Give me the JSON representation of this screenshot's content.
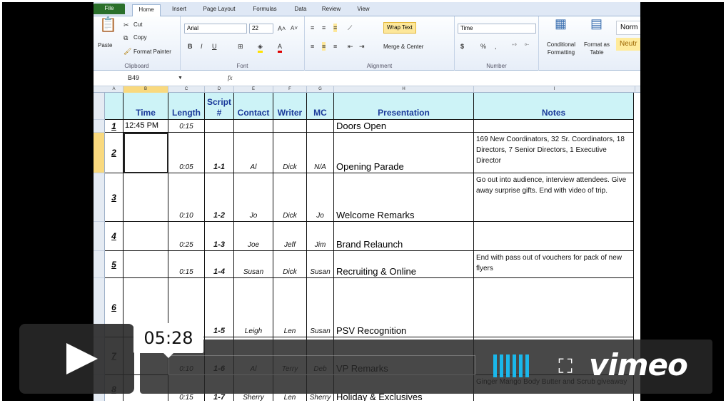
{
  "ribbon": {
    "tabs": [
      "File",
      "Home",
      "Insert",
      "Page Layout",
      "Formulas",
      "Data",
      "Review",
      "View"
    ],
    "active_tab": "Home",
    "clipboard": {
      "paste": "Paste",
      "cut": "Cut",
      "copy": "Copy",
      "format_painter": "Format Painter",
      "label": "Clipboard"
    },
    "font": {
      "name": "Arial",
      "size": "22",
      "label": "Font",
      "bold": "B",
      "italic": "I",
      "underline": "U"
    },
    "alignment": {
      "wrap_text": "Wrap Text",
      "merge": "Merge & Center",
      "label": "Alignment"
    },
    "number": {
      "format": "Time",
      "currency": "$",
      "percent": "%",
      "comma": ",",
      "label": "Number"
    },
    "styles": {
      "conditional": "Conditional Formatting",
      "format_table": "Format as Table",
      "normal": "Norm",
      "neutral": "Neutr"
    }
  },
  "formula_bar": {
    "name_box": "B49",
    "fx": "fx",
    "value": ""
  },
  "columns": [
    "A",
    "B",
    "C",
    "D",
    "E",
    "F",
    "G",
    "H",
    "I"
  ],
  "headers": {
    "time": "Time",
    "length": "Length",
    "script": "Script #",
    "contact": "Contact",
    "writer": "Writer",
    "mc": "MC",
    "presentation": "Presentation",
    "notes": "Notes"
  },
  "rows": [
    {
      "n": "1",
      "time": "12:45 PM",
      "length": "0:15",
      "script": "",
      "contact": "",
      "writer": "",
      "mc": "",
      "presentation": "Doors Open",
      "notes": ""
    },
    {
      "n": "2",
      "time": "",
      "length": "0:05",
      "script": "1-1",
      "contact": "Al",
      "writer": "Dick",
      "mc": "N/A",
      "presentation": "Opening Parade",
      "notes": "169 New Coordinators, 32 Sr. Coordinators, 18 Directors, 7 Senior Directors, 1 Executive Director"
    },
    {
      "n": "3",
      "time": "",
      "length": "0:10",
      "script": "1-2",
      "contact": "Jo",
      "writer": "Dick",
      "mc": "Jo",
      "presentation": "Welcome Remarks",
      "notes": "Go out into audience, interview attendees. Give away surprise gifts.  End with video of trip."
    },
    {
      "n": "4",
      "time": "",
      "length": "0:25",
      "script": "1-3",
      "contact": "Joe",
      "writer": "Jeff",
      "mc": "Jim",
      "presentation": "Brand Relaunch",
      "notes": ""
    },
    {
      "n": "5",
      "time": "",
      "length": "0:15",
      "script": "1-4",
      "contact": "Susan",
      "writer": "Dick",
      "mc": "Susan",
      "presentation": "Recruiting & Online",
      "notes": "End with pass out of vouchers for pack of new flyers"
    },
    {
      "n": "6",
      "time": "",
      "length": "",
      "script": "1-5",
      "contact": "Leigh",
      "writer": "Len",
      "mc": "Susan",
      "presentation": "PSV Recognition",
      "notes": ""
    },
    {
      "n": "7",
      "time": "",
      "length": "0:10",
      "script": "1-6",
      "contact": "Al",
      "writer": "Terry",
      "mc": "Deb",
      "presentation": "VP Remarks",
      "notes": ""
    },
    {
      "n": "8",
      "time": "",
      "length": "0:15",
      "script": "1-7",
      "contact": "Sherry",
      "writer": "Len",
      "mc": "Sherry",
      "presentation": "Holiday & Exclusives",
      "notes": "Ginger Mango Body Butter and Scrub giveaway"
    }
  ],
  "player": {
    "timestamp": "05:28",
    "brand": "vimeo",
    "accent": "#1ab7ea"
  }
}
